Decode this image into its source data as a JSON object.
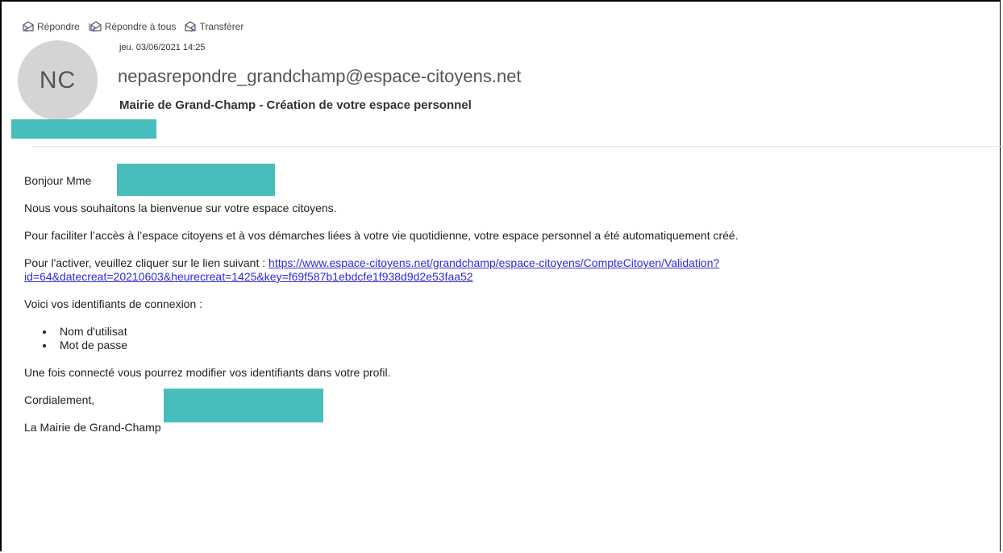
{
  "toolbar": {
    "reply_label": "Répondre",
    "reply_all_label": "Répondre à tous",
    "forward_label": "Transférer"
  },
  "message": {
    "avatar_initials": "NC",
    "date": "jeu. 03/06/2021 14:25",
    "sender": "nepasrepondre_grandchamp@espace-citoyens.net",
    "subject": "Mairie de Grand-Champ -  Création de votre espace personnel"
  },
  "body": {
    "greeting": "Bonjour Mme",
    "welcome": "Nous vous souhaitons la bienvenue sur votre espace citoyens.",
    "intro": "Pour faciliter l’accès à l’espace citoyens et à vos démarches liées à votre vie quotidienne, votre espace personnel a été automatiquement créé.",
    "activate_prefix": "Pour l'activer, veuillez cliquer sur le lien suivant : ",
    "activate_link_line1": "https://www.espace-citoyens.net/grandchamp/espace-citoyens/CompteCitoyen/Validation?",
    "activate_link_line2": "id=64&datecreat=20210603&heurecreat=1425&key=f69f587b1ebdcfe1f938d9d2e53faa52",
    "credentials_intro": "Voici vos identifiants de connexion :",
    "credentials": [
      {
        "label": "Nom d'utilisat"
      },
      {
        "label": "Mot de passe"
      }
    ],
    "after_login": "Une fois connecté vous pourrez modifier vos identifiants dans votre profil.",
    "closing": "Cordialement,",
    "signature": "La Mairie de Grand-Champ"
  },
  "colors": {
    "redaction": "#47bebb",
    "link": "#2f2ae0",
    "avatar_bg": "#d4d4d4"
  }
}
